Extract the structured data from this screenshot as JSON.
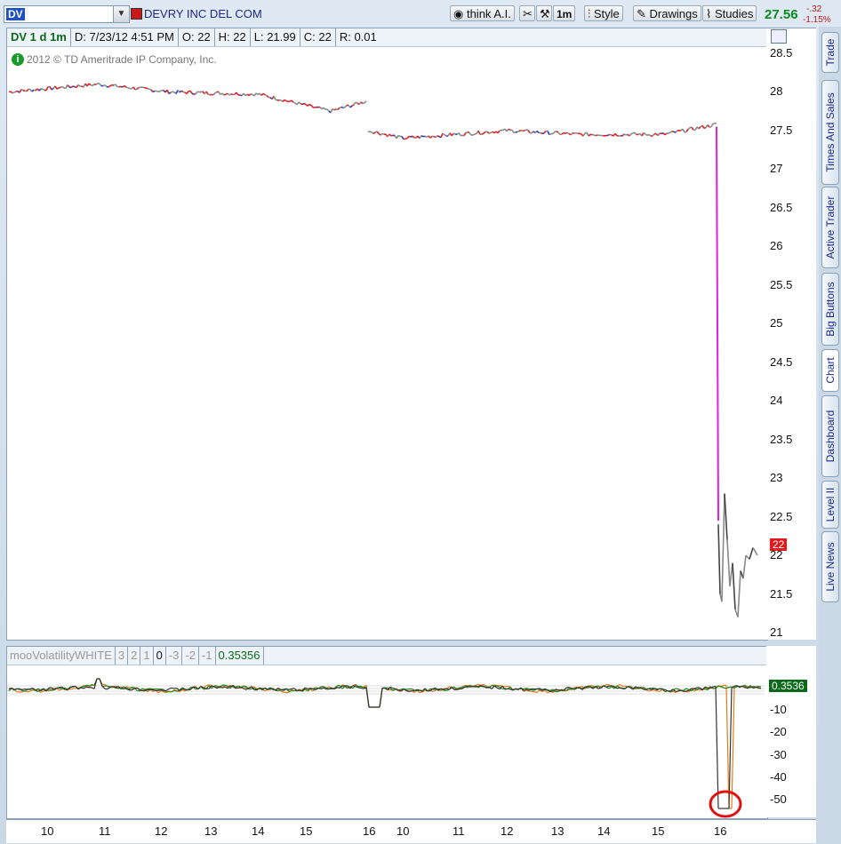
{
  "toolbar": {
    "symbol": "DV",
    "company_name": "DEVRY INC DEL COM",
    "think_ai_label": "think A.I.",
    "timeframe_label": "1m",
    "style_label": "Style",
    "drawings_label": "Drawings",
    "studies_label": "Studies",
    "last_price": "27.56",
    "net_change": "-.32",
    "percent_change": "-1.15%"
  },
  "info_bar": {
    "title": "DV 1 d 1m",
    "date": "D: 7/23/12 4:51 PM",
    "open": "O: 22",
    "high": "H: 22",
    "low": "L: 21.99",
    "close": "C: 22",
    "range": "R: 0.01"
  },
  "copyright": "2012 © TD Ameritrade IP Company, Inc.",
  "price_axis": [
    "28.5",
    "28",
    "27.5",
    "27",
    "26.5",
    "26",
    "25.5",
    "25",
    "24.5",
    "24",
    "23.5",
    "23",
    "22.5",
    "22",
    "21.5",
    "21"
  ],
  "current_price_tag": "22",
  "indicator": {
    "name": "mooVolatilityWHITE",
    "params": [
      "3",
      "2",
      "1",
      "0",
      "-3",
      "-2",
      "-1"
    ],
    "value": "0.35356",
    "value_tag": "0.3536",
    "axis": [
      "-10",
      "-20",
      "-30",
      "-40",
      "-50"
    ]
  },
  "time_axis": [
    "10",
    "11",
    "12",
    "13",
    "14",
    "15",
    "16",
    "10",
    "11",
    "12",
    "13",
    "14",
    "15",
    "16"
  ],
  "side_tabs": [
    "Trade",
    "Times And Sales",
    "Active Trader",
    "Big Buttons",
    "Chart",
    "Dashboard",
    "Level II",
    "Live News"
  ],
  "colors": {
    "up": "#e02020",
    "down": "#1a3ad0",
    "drop": "#e020e0",
    "neutral": "#888888",
    "indicator_green": "#1a8a1a",
    "indicator_orange": "#e87a1a",
    "marker": "#e01010"
  },
  "chart_data": {
    "type": "line",
    "title": "DV 1 d 1m",
    "xlabel": "",
    "ylabel": "",
    "ylim": [
      21,
      28.6
    ],
    "series": [
      {
        "name": "",
        "x": [
          "10",
          "11",
          "12",
          "13",
          "14",
          "15",
          "15.9",
          "16"
        ],
        "values": [
          28.0,
          28.1,
          28.0,
          27.95,
          27.95,
          27.8,
          27.85,
          27.85
        ]
      },
      {
        "name": "",
        "x": [
          "16",
          "10",
          "11",
          "12",
          "13",
          "14",
          "15",
          "15.9",
          "16"
        ],
        "values": [
          27.5,
          27.4,
          27.5,
          27.5,
          27.45,
          27.45,
          27.5,
          27.55,
          22.0
        ]
      }
    ]
  }
}
